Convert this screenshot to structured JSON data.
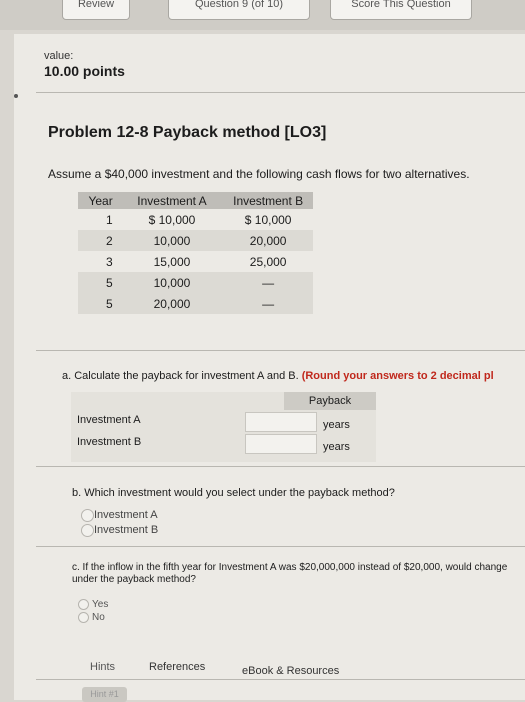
{
  "topbar": {
    "review": "Review",
    "question": "Question 9 (of 10)",
    "score": "Score This Question"
  },
  "value": {
    "label": "value:",
    "points": "10.00 points"
  },
  "problem": {
    "title": "Problem 12-8 Payback method [LO3]",
    "intro": "Assume a $40,000 investment and the following cash flows for two alternatives."
  },
  "cash_flows": {
    "headers": [
      "Year",
      "Investment A",
      "Investment B"
    ],
    "rows": [
      [
        "1",
        "$ 10,000",
        "$ 10,000"
      ],
      [
        "2",
        "10,000",
        "20,000"
      ],
      [
        "3",
        "15,000",
        "25,000"
      ],
      [
        "5",
        "10,000",
        "—"
      ],
      [
        "5",
        "20,000",
        "—"
      ]
    ]
  },
  "part_a": {
    "question": "a. Calculate the payback for investment A and B.",
    "instruction": "(Round your answers to 2 decimal pl",
    "column_header": "Payback",
    "rows": [
      {
        "label": "Investment A",
        "value": "",
        "unit": "years"
      },
      {
        "label": "Investment B",
        "value": "",
        "unit": "years"
      }
    ]
  },
  "part_b": {
    "question": "b. Which investment would you select under the payback method?",
    "options": [
      "Investment A",
      "Investment B"
    ]
  },
  "part_c": {
    "question": "c. If the inflow in the fifth year for Investment A was $20,000,000 instead of $20,000, would change under the payback method?",
    "options": [
      "Yes",
      "No"
    ]
  },
  "footer": {
    "hints": "Hints",
    "references": "References",
    "ebook": "eBook & Resources",
    "hint_button": "Hint #1"
  }
}
